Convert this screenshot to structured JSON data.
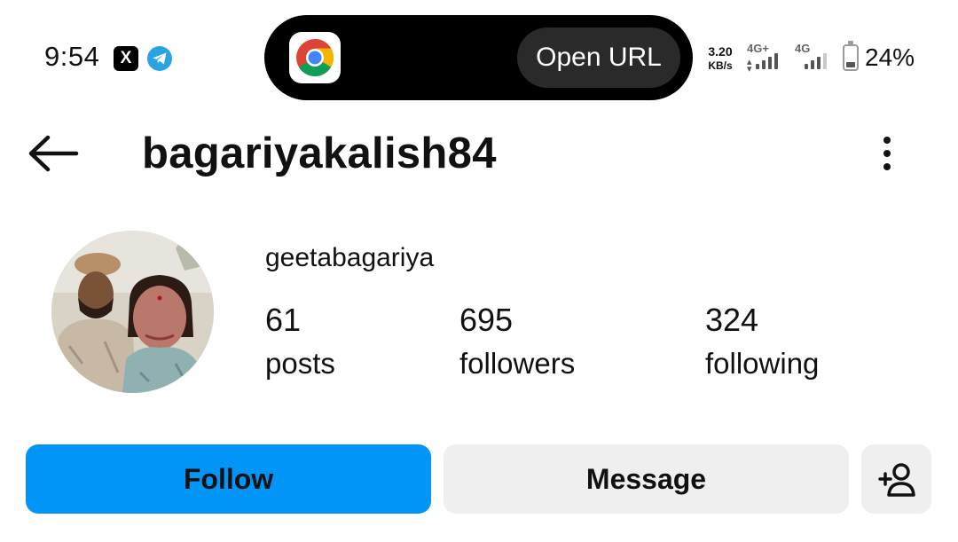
{
  "status_bar": {
    "time": "9:54",
    "app_icons": [
      "x-icon",
      "telegram-icon"
    ],
    "x_glyph": "X",
    "net_speed_value": "3.20",
    "net_speed_unit": "KB/s",
    "sim1_label": "4G+",
    "sim2_label": "4G",
    "battery_percent": "24%",
    "battery_level": 0.24
  },
  "notification_island": {
    "app_icon": "chrome-icon",
    "action_label": "Open URL"
  },
  "header": {
    "username": "bagariyakalish84",
    "back_icon": "arrow-left-icon",
    "menu_icon": "more-vertical-icon"
  },
  "profile": {
    "display_name": "geetabagariya",
    "stats": {
      "posts": {
        "count": "61",
        "label": "posts"
      },
      "followers": {
        "count": "695",
        "label": "followers"
      },
      "following": {
        "count": "324",
        "label": "following"
      }
    }
  },
  "actions": {
    "follow_label": "Follow",
    "message_label": "Message",
    "add_user_icon": "person-add-icon"
  },
  "colors": {
    "accent": "#0095f6",
    "secondary_button": "#efefef",
    "island": "#000000"
  }
}
